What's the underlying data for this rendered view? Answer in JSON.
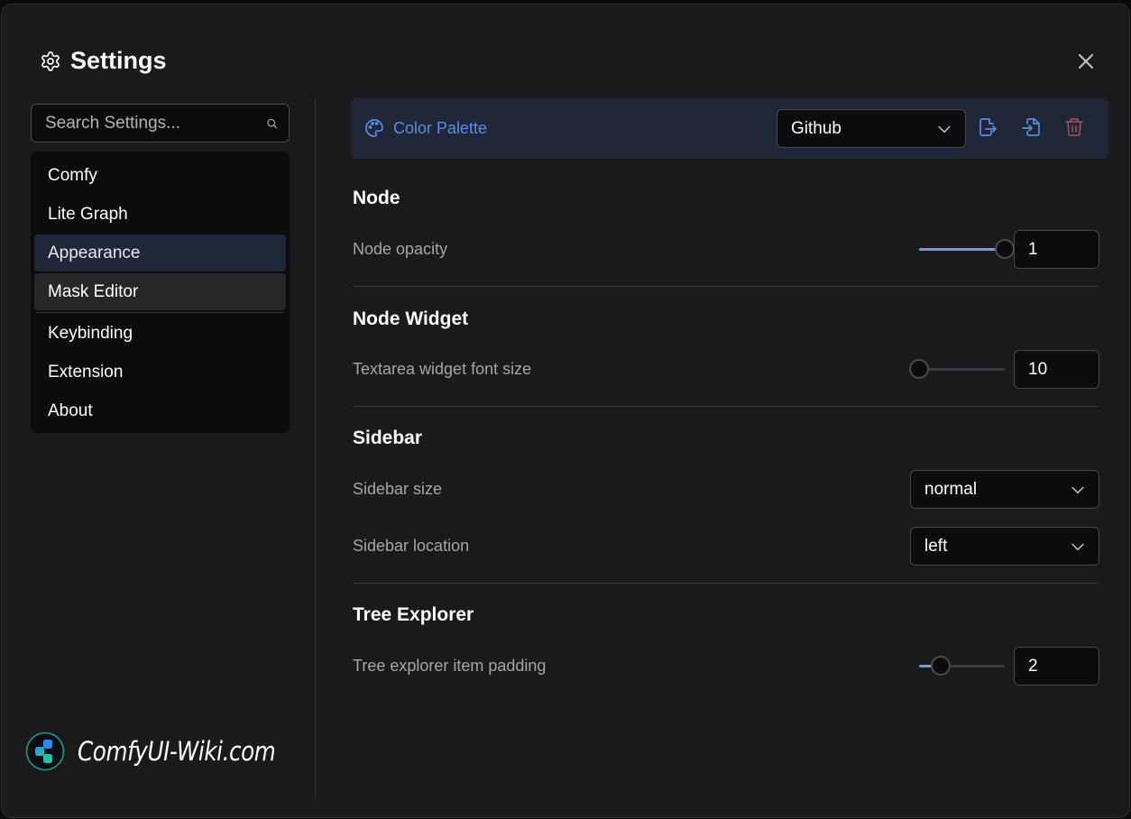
{
  "dialog": {
    "title": "Settings",
    "close_icon": "close-icon",
    "title_icon": "gear-icon"
  },
  "search": {
    "placeholder": "Search Settings...",
    "value": "",
    "icon": "search-icon"
  },
  "sidebar": {
    "items": [
      {
        "label": "Comfy",
        "state": "normal"
      },
      {
        "label": "Lite Graph",
        "state": "normal"
      },
      {
        "label": "Appearance",
        "state": "selected"
      },
      {
        "label": "Mask Editor",
        "state": "hover"
      },
      {
        "label": "Keybinding",
        "state": "normal"
      },
      {
        "label": "Extension",
        "state": "normal"
      },
      {
        "label": "About",
        "state": "normal"
      }
    ]
  },
  "brand": {
    "text": "ComfyUI-Wiki.com",
    "icon": "comfyui-logo-icon"
  },
  "palette": {
    "label": "Color Palette",
    "icon": "palette-icon",
    "selected": "Github",
    "actions": [
      {
        "name": "export",
        "icon": "file-export-icon",
        "color": "#5b8de0"
      },
      {
        "name": "import",
        "icon": "file-import-icon",
        "color": "#5b8de0"
      },
      {
        "name": "delete",
        "icon": "trash-icon",
        "color": "#9a4d5a"
      }
    ]
  },
  "sections": [
    {
      "title": "Node",
      "settings": [
        {
          "label": "Node opacity",
          "type": "slider",
          "value": "1",
          "fraction": 1.0
        }
      ]
    },
    {
      "title": "Node Widget",
      "settings": [
        {
          "label": "Textarea widget font size",
          "type": "slider",
          "value": "10",
          "fraction": 0.0
        }
      ]
    },
    {
      "title": "Sidebar",
      "settings": [
        {
          "label": "Sidebar size",
          "type": "select",
          "value": "normal"
        },
        {
          "label": "Sidebar location",
          "type": "select",
          "value": "left"
        }
      ]
    },
    {
      "title": "Tree Explorer",
      "settings": [
        {
          "label": "Tree explorer item padding",
          "type": "slider",
          "value": "2",
          "fraction": 0.25
        }
      ]
    }
  ],
  "colors": {
    "accent": "#5b8de0",
    "slider_fill": "#6f9ee6",
    "danger": "#9a4d5a",
    "selected_nav": "#1d2737",
    "palette_bar": "#1f2638"
  }
}
